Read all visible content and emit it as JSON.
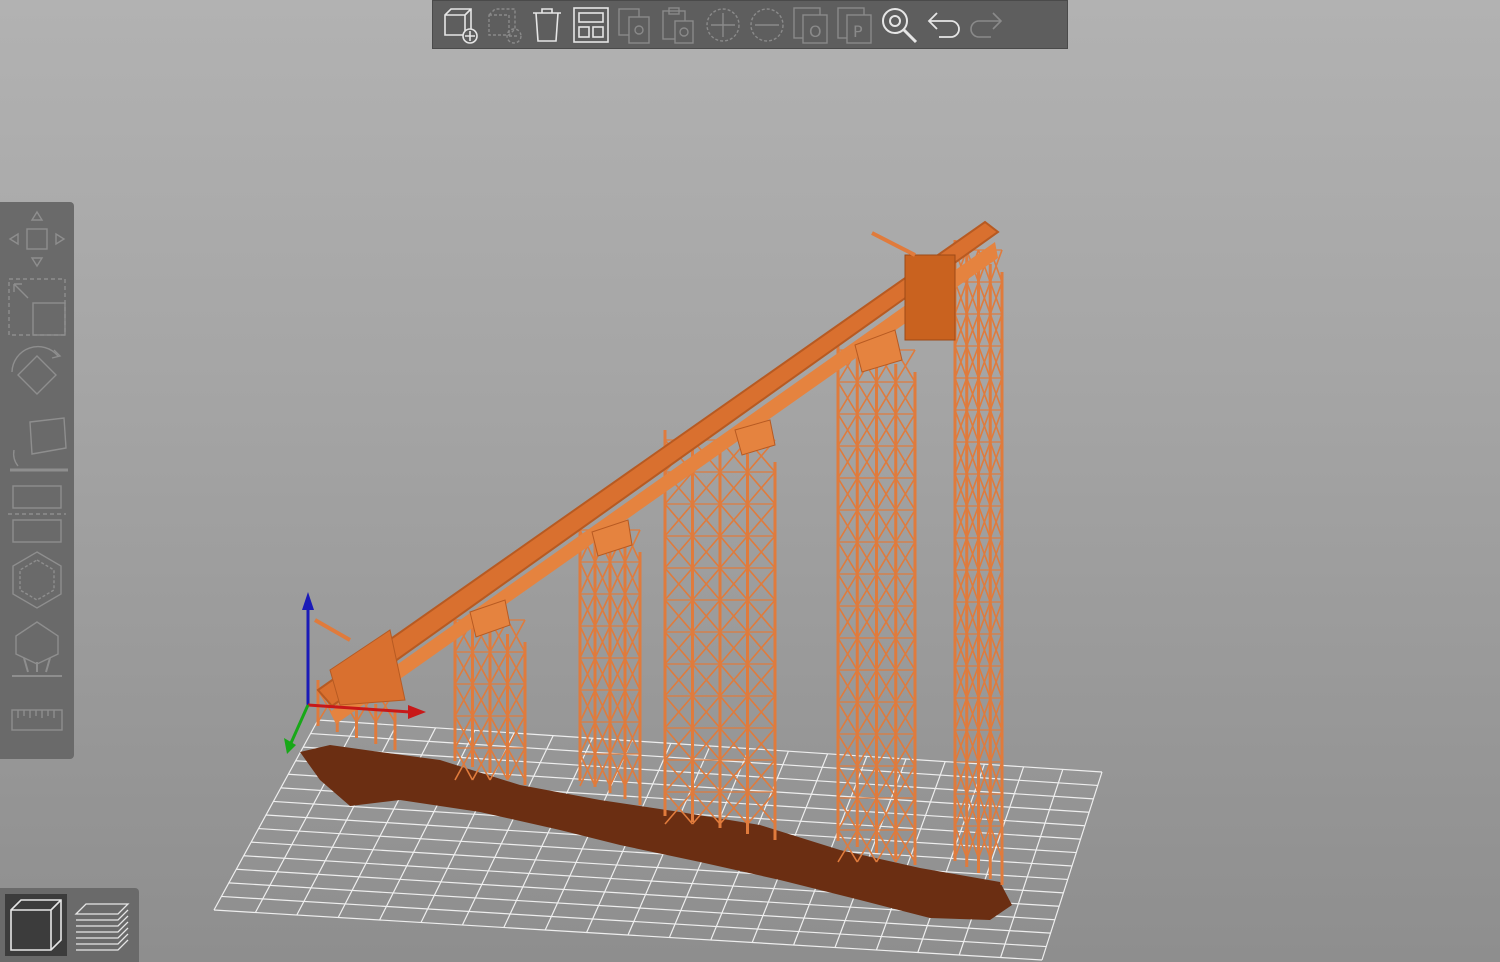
{
  "app": {
    "view": "3d-support-preview",
    "model_color": "#e07b3c",
    "shadow_color": "#6b2e12",
    "grid_color": "#e8e8e8"
  },
  "top_toolbar": {
    "buttons": [
      {
        "id": "add-model",
        "icon": "cube-plus-icon",
        "enabled": true
      },
      {
        "id": "remove-model",
        "icon": "cube-minus-icon",
        "enabled": false
      },
      {
        "id": "delete",
        "icon": "trash-icon",
        "enabled": true
      },
      {
        "id": "arrange",
        "icon": "arrange-icon",
        "enabled": true
      },
      {
        "id": "copy",
        "icon": "copy-icon",
        "enabled": false
      },
      {
        "id": "paste",
        "icon": "paste-icon",
        "enabled": false
      },
      {
        "id": "add-instance",
        "icon": "plus-circle-icon",
        "enabled": false
      },
      {
        "id": "remove-instance",
        "icon": "minus-circle-icon",
        "enabled": false
      },
      {
        "id": "split-objects",
        "icon": "split-objects-icon",
        "enabled": false
      },
      {
        "id": "split-parts",
        "icon": "split-parts-icon",
        "enabled": false
      },
      {
        "id": "search",
        "icon": "search-icon",
        "enabled": true
      },
      {
        "id": "undo",
        "icon": "undo-icon",
        "enabled": true
      },
      {
        "id": "redo",
        "icon": "redo-icon",
        "enabled": false
      }
    ]
  },
  "left_toolbar": {
    "tools": [
      {
        "id": "move",
        "icon": "move-icon"
      },
      {
        "id": "scale",
        "icon": "scale-icon"
      },
      {
        "id": "rotate",
        "icon": "rotate-icon"
      },
      {
        "id": "place-on-face",
        "icon": "place-on-face-icon"
      },
      {
        "id": "cut",
        "icon": "cut-icon"
      },
      {
        "id": "hollow",
        "icon": "hollow-icon"
      },
      {
        "id": "support-points",
        "icon": "support-points-icon"
      },
      {
        "id": "measure",
        "icon": "ruler-icon"
      }
    ]
  },
  "view_toggle": {
    "buttons": [
      {
        "id": "3d-view",
        "icon": "cube-view-icon",
        "active": true
      },
      {
        "id": "preview",
        "icon": "layers-icon",
        "active": false
      }
    ]
  }
}
